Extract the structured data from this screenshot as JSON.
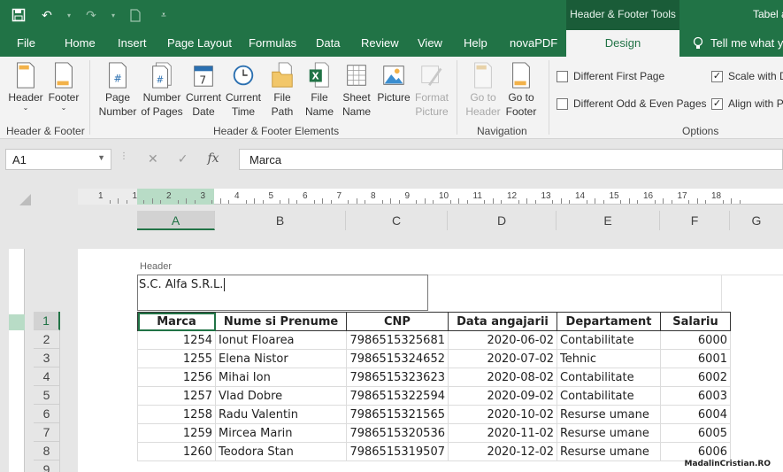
{
  "titlebar": {
    "context_title": "Header & Footer Tools",
    "doc_title": "Tabel a",
    "qat": {
      "save_icon": "save-icon",
      "undo_icon": "undo-icon",
      "redo_icon": "redo-icon",
      "new_icon": "new-doc-icon",
      "customize_icon": "customize-qat-icon"
    }
  },
  "tabs": [
    "File",
    "Home",
    "Insert",
    "Page Layout",
    "Formulas",
    "Data",
    "Review",
    "View",
    "Help",
    "novaPDF",
    "Design"
  ],
  "tell_me": "Tell me what y",
  "ribbon": {
    "header_footer": {
      "header": "Header",
      "footer": "Footer",
      "label": "Header & Footer"
    },
    "elements": {
      "page_number": [
        "Page",
        "Number"
      ],
      "number_of_pages": [
        "Number",
        "of Pages"
      ],
      "current_date": [
        "Current",
        "Date"
      ],
      "current_time": [
        "Current",
        "Time"
      ],
      "file_path": [
        "File",
        "Path"
      ],
      "file_name": [
        "File",
        "Name"
      ],
      "sheet_name": [
        "Sheet",
        "Name"
      ],
      "picture": [
        "Picture",
        ""
      ],
      "format_picture": [
        "Format",
        "Picture"
      ],
      "label": "Header & Footer Elements"
    },
    "navigation": {
      "go_header": [
        "Go to",
        "Header"
      ],
      "go_footer": [
        "Go to",
        "Footer"
      ],
      "label": "Navigation"
    },
    "options": {
      "different_first_page": "Different First Page",
      "different_odd_even": "Different Odd & Even Pages",
      "scale_with": "Scale with D",
      "align_with": "Align with P",
      "label": "Options"
    }
  },
  "formula_bar": {
    "name_box": "A1",
    "content": "Marca",
    "cancel_icon": "✕",
    "enter_icon": "✓",
    "fx": "fx"
  },
  "ruler_numbers": [
    "1",
    "1",
    "2",
    "3",
    "4",
    "5",
    "6",
    "7",
    "8",
    "9",
    "10",
    "11",
    "12",
    "13",
    "14",
    "15",
    "16",
    "17",
    "18"
  ],
  "columns": [
    "A",
    "B",
    "C",
    "D",
    "E",
    "F",
    "G"
  ],
  "rows": [
    "1",
    "2",
    "3",
    "4",
    "5",
    "6",
    "7",
    "8",
    "9"
  ],
  "page": {
    "header_label": "Header",
    "header_text": "S.C. Alfa S.R.L."
  },
  "table": {
    "headers": [
      "Marca",
      "Nume si Prenume",
      "CNP",
      "Data angajarii",
      "Departament",
      "Salariu"
    ],
    "rows": [
      [
        "1254",
        "Ionut Floarea",
        "7986515325681",
        "2020-06-02",
        "Contabilitate",
        "6000"
      ],
      [
        "1255",
        "Elena Nistor",
        "7986515324652",
        "2020-07-02",
        "Tehnic",
        "6001"
      ],
      [
        "1256",
        "Mihai Ion",
        "7986515323623",
        "2020-08-02",
        "Contabilitate",
        "6002"
      ],
      [
        "1257",
        "Vlad Dobre",
        "7986515322594",
        "2020-09-02",
        "Contabilitate",
        "6003"
      ],
      [
        "1258",
        "Radu Valentin",
        "7986515321565",
        "2020-10-02",
        "Resurse umane",
        "6004"
      ],
      [
        "1259",
        "Mircea Marin",
        "7986515320536",
        "2020-11-02",
        "Resurse umane",
        "6005"
      ],
      [
        "1260",
        "Teodora Stan",
        "7986515319507",
        "2020-12-02",
        "Resurse umane",
        "6006"
      ]
    ]
  },
  "watermark": "MadalinCristian.RO",
  "colors": {
    "accent": "#217346",
    "context": "#1a5c38"
  }
}
